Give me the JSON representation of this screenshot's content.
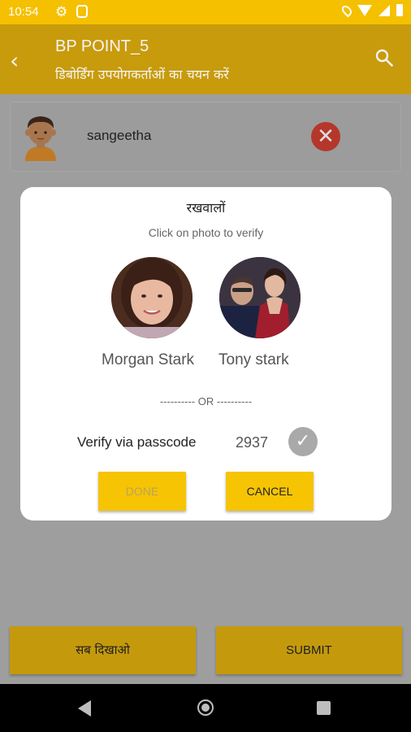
{
  "status_bar": {
    "time": "10:54"
  },
  "app_bar": {
    "title": "BP POINT_5",
    "subtitle": "डिबोर्डिंग उपयोगकर्ताओं का चयन करें"
  },
  "user_card": {
    "name": "sangeetha"
  },
  "dialog": {
    "title": "रखवालों",
    "subtitle": "Click on photo to verify",
    "guardians": [
      {
        "name": "Morgan Stark"
      },
      {
        "name": "Tony stark"
      }
    ],
    "or_text": "---------- OR ----------",
    "verify_label": "Verify via passcode",
    "passcode": "2937",
    "done_label": "DONE",
    "cancel_label": "CANCEL"
  },
  "bottom_actions": {
    "show_all_label": "सब दिखाओ",
    "submit_label": "SUBMIT"
  },
  "colors": {
    "accent": "#f5c000",
    "accent_dimmed": "#c89b0c",
    "remove": "#b5372a"
  }
}
